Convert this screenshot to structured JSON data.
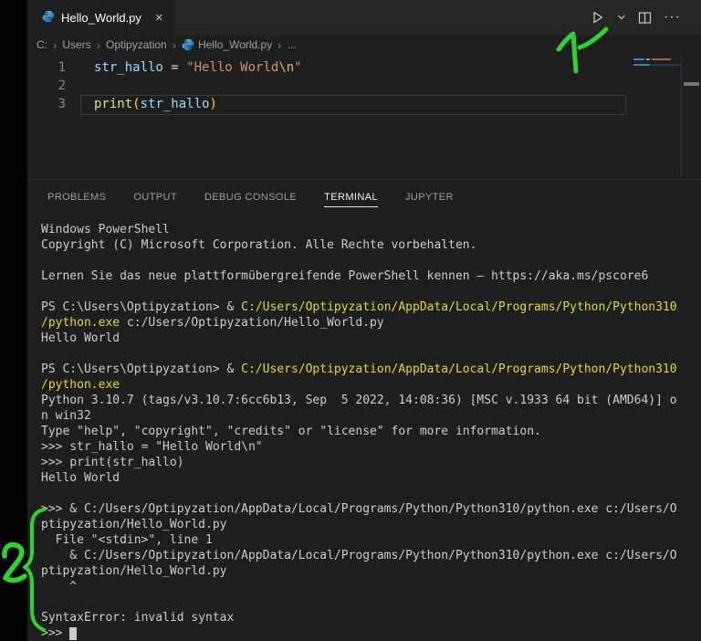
{
  "tab": {
    "label": "Hello_World.py",
    "close": "×"
  },
  "editor_actions": {
    "run_tooltip": "Run Python File",
    "split_tooltip": "Split Editor",
    "more_tooltip": "More Actions"
  },
  "breadcrumbs": {
    "separator": "›",
    "items": [
      {
        "label": "C:",
        "icon": false
      },
      {
        "label": "Users",
        "icon": false
      },
      {
        "label": "Optipyzation",
        "icon": false
      },
      {
        "label": "Hello_World.py",
        "icon": true
      },
      {
        "label": "...",
        "icon": false
      }
    ]
  },
  "code": {
    "lines": [
      {
        "num": "1",
        "current": false,
        "tokens": [
          {
            "t": "str_hallo",
            "c": "#9CDCFE"
          },
          {
            "t": " = ",
            "c": "#D4D4D4"
          },
          {
            "t": "\"Hello World",
            "c": "#CE9178"
          },
          {
            "t": "\\n",
            "c": "#D7BA7D"
          },
          {
            "t": "\"",
            "c": "#CE9178"
          }
        ]
      },
      {
        "num": "2",
        "current": false,
        "tokens": []
      },
      {
        "num": "3",
        "current": true,
        "tokens": [
          {
            "t": "print",
            "c": "#DCDCAA"
          },
          {
            "t": "(",
            "c": "#FFD700"
          },
          {
            "t": "str_hallo",
            "c": "#9CDCFE"
          },
          {
            "t": ")",
            "c": "#FFD700"
          }
        ]
      }
    ]
  },
  "panel": {
    "tabs": [
      {
        "label": "PROBLEMS",
        "active": false
      },
      {
        "label": "OUTPUT",
        "active": false
      },
      {
        "label": "DEBUG CONSOLE",
        "active": false
      },
      {
        "label": "TERMINAL",
        "active": true
      },
      {
        "label": "JUPYTER",
        "active": false
      }
    ]
  },
  "terminal": {
    "lines": [
      {
        "segs": [
          {
            "t": "Windows PowerShell"
          }
        ]
      },
      {
        "segs": [
          {
            "t": "Copyright (C) Microsoft Corporation. Alle Rechte vorbehalten."
          }
        ]
      },
      {
        "segs": []
      },
      {
        "segs": [
          {
            "t": "Lernen Sie das neue plattformübergreifende PowerShell kennen – https://aka.ms/pscore6"
          }
        ]
      },
      {
        "segs": []
      },
      {
        "segs": [
          {
            "t": "PS C:\\Users\\Optipyzation> & "
          },
          {
            "t": "C:/Users/Optipyzation/AppData/Local/Programs/Python/Python310",
            "y": true
          }
        ]
      },
      {
        "segs": [
          {
            "t": "/python.exe",
            "y": true
          },
          {
            "t": " c:/Users/Optipyzation/Hello_World.py"
          }
        ]
      },
      {
        "segs": [
          {
            "t": "Hello World"
          }
        ]
      },
      {
        "segs": []
      },
      {
        "segs": [
          {
            "t": "PS C:\\Users\\Optipyzation> & "
          },
          {
            "t": "C:/Users/Optipyzation/AppData/Local/Programs/Python/Python310",
            "y": true
          }
        ]
      },
      {
        "segs": [
          {
            "t": "/python.exe",
            "y": true
          }
        ]
      },
      {
        "segs": [
          {
            "t": "Python 3.10.7 (tags/v3.10.7:6cc6b13, Sep  5 2022, 14:08:36) [MSC v.1933 64 bit (AMD64)] o"
          }
        ]
      },
      {
        "segs": [
          {
            "t": "n win32"
          }
        ]
      },
      {
        "segs": [
          {
            "t": "Type \"help\", \"copyright\", \"credits\" or \"license\" for more information."
          }
        ]
      },
      {
        "segs": [
          {
            "t": ">>> str_hallo = \"Hello World\\n\""
          }
        ]
      },
      {
        "segs": [
          {
            "t": ">>> print(str_hallo)"
          }
        ]
      },
      {
        "segs": [
          {
            "t": "Hello World"
          }
        ]
      },
      {
        "segs": []
      },
      {
        "segs": [
          {
            "t": ">>> & C:/Users/Optipyzation/AppData/Local/Programs/Python/Python310/python.exe c:/Users/O"
          }
        ]
      },
      {
        "segs": [
          {
            "t": "ptipyzation/Hello_World.py"
          }
        ]
      },
      {
        "segs": [
          {
            "t": "  File \"<stdin>\", line 1"
          }
        ]
      },
      {
        "segs": [
          {
            "t": "    & C:/Users/Optipyzation/AppData/Local/Programs/Python/Python310/python.exe c:/Users/O"
          }
        ]
      },
      {
        "segs": [
          {
            "t": "ptipyzation/Hello_World.py"
          }
        ]
      },
      {
        "segs": [
          {
            "t": "    ^"
          }
        ]
      },
      {
        "segs": []
      },
      {
        "segs": [
          {
            "t": "SyntaxError: invalid syntax"
          }
        ]
      },
      {
        "segs": [
          {
            "t": ">>> "
          },
          {
            "t": " ",
            "cursor": true
          }
        ]
      }
    ]
  },
  "annotations": {
    "color": "#2fd32f",
    "labels": [
      "1",
      "2"
    ]
  }
}
